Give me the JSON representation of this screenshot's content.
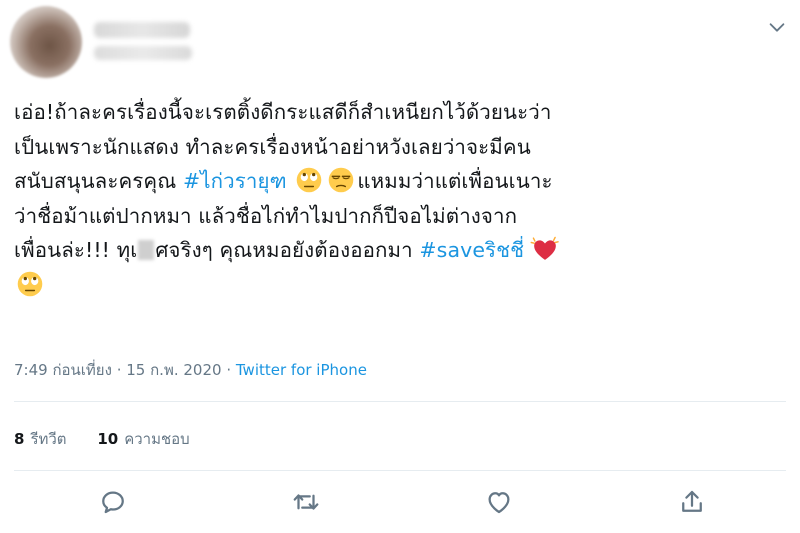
{
  "tweet": {
    "lines": [
      {
        "segments": [
          {
            "text": "เอ่อ!ถ้าละครเรื่องนี้จะเรตติ้งดีกระแสดีก็สำเหนียกไว้ด้วยนะว่า"
          }
        ]
      },
      {
        "segments": [
          {
            "text": "เป็นเพราะนักแสดง ทำละครเรื่องหน้าอย่าหวังเลยว่าจะมีคน"
          }
        ]
      },
      {
        "segments": [
          {
            "text": "สนับสนุนละครคุณ "
          },
          {
            "text": "#ไก่วรายุฑ",
            "hashtag": true
          },
          {
            "text": " "
          },
          {
            "emoji": "rolling-eyes"
          },
          {
            "emoji": "unamused"
          },
          {
            "text": "แหมมว่าแต่เพื่อนเนาะ"
          }
        ]
      },
      {
        "segments": [
          {
            "text": "ว่าชื่อม้าแต่ปากหมา แล้วชื่อไก่ทำไมปากก็ปีจอไม่ต่างจาก"
          }
        ]
      },
      {
        "segments": [
          {
            "text": "เพื่อนล่ะ!!! ทุเ"
          },
          {
            "censored": true
          },
          {
            "text": "ศจริงๆ คุณหมอยังต้องออกมา "
          },
          {
            "text": "#saveริชชี่",
            "hashtag": true
          },
          {
            "emoji": "heart"
          }
        ]
      },
      {
        "segments": [
          {
            "emoji": "rolling-eyes"
          }
        ]
      }
    ],
    "time": "7:49 ก่อนเที่ยง",
    "separator": " · ",
    "date": "15 ก.พ. 2020",
    "source": "Twitter for iPhone",
    "retweets_count": "8",
    "retweets_label": "รีทวีต",
    "likes_count": "10",
    "likes_label": "ความชอบ"
  },
  "colors": {
    "link": "#1b95e0",
    "text": "#14171a",
    "muted": "#657786",
    "divider": "#e6ecf0"
  },
  "icons": {
    "menu": "chevron-down-icon",
    "reply": "reply-icon",
    "retweet": "retweet-icon",
    "like": "heart-outline-icon",
    "share": "share-icon"
  }
}
